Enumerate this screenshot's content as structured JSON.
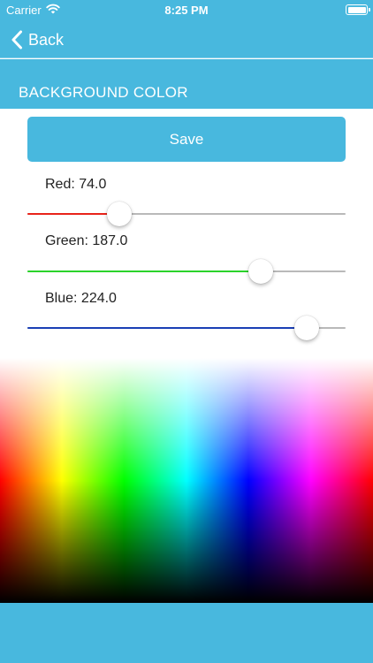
{
  "status_bar": {
    "carrier": "Carrier",
    "time": "8:25 PM",
    "battery_level": 1.0
  },
  "nav": {
    "back_label": "Back"
  },
  "section": {
    "title": "BACKGROUND COLOR"
  },
  "save_label": "Save",
  "sliders": [
    {
      "label": "Red: 74.0",
      "value": 74.0,
      "max": 255,
      "color": "#e8231a"
    },
    {
      "label": "Green: 187.0",
      "value": 187.0,
      "max": 255,
      "color": "#2ad32a"
    },
    {
      "label": "Blue: 224.0",
      "value": 224.0,
      "max": 255,
      "color": "#1a3fb5"
    }
  ],
  "colors": {
    "accent": "#48b8de",
    "track_empty": "#b9b9b9"
  }
}
